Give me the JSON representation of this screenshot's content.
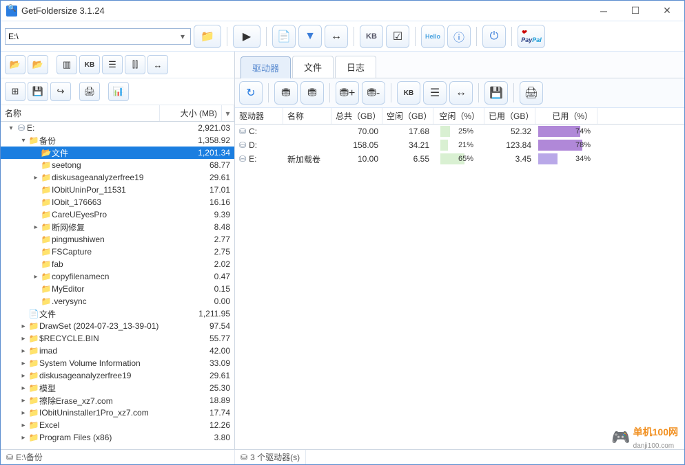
{
  "title": "GetFoldersize 3.1.24",
  "path_value": "E:\\",
  "left_columns": {
    "name": "名称",
    "size": "大小 (MB)"
  },
  "right_columns": {
    "drive": "驱动器",
    "name": "名称",
    "total": "总共（GB）",
    "free": "空闲（GB）",
    "free_pct": "空闲（%）",
    "used": "已用（GB）",
    "used_pct": "已用（%）"
  },
  "tabs": {
    "drives": "驱动器",
    "files": "文件",
    "log": "日志"
  },
  "status": {
    "path": "E:\\备份",
    "drives": "3 个驱动器(s)"
  },
  "watermark": {
    "line1": "单机100网",
    "line2": "danji100.com"
  },
  "tree": [
    {
      "depth": 0,
      "expand": "open",
      "icon": "drive",
      "name": "E:",
      "size": "2,921.03"
    },
    {
      "depth": 1,
      "expand": "open",
      "icon": "folder",
      "name": "备份",
      "size": "1,358.92"
    },
    {
      "depth": 2,
      "expand": "none",
      "icon": "folder-open",
      "name": "文件",
      "size": "1,201.34",
      "selected": true
    },
    {
      "depth": 2,
      "expand": "none",
      "icon": "folder",
      "name": "seetong",
      "size": "68.77"
    },
    {
      "depth": 2,
      "expand": "closed",
      "icon": "folder",
      "name": "diskusageanalyzerfree19",
      "size": "29.61"
    },
    {
      "depth": 2,
      "expand": "none",
      "icon": "folder",
      "name": "IObitUninPor_11531",
      "size": "17.01"
    },
    {
      "depth": 2,
      "expand": "none",
      "icon": "folder",
      "name": "IObit_176663",
      "size": "16.16"
    },
    {
      "depth": 2,
      "expand": "none",
      "icon": "folder",
      "name": "CareUEyesPro",
      "size": "9.39"
    },
    {
      "depth": 2,
      "expand": "closed",
      "icon": "folder",
      "name": "断网修复",
      "size": "8.48"
    },
    {
      "depth": 2,
      "expand": "none",
      "icon": "folder",
      "name": "pingmushiwen",
      "size": "2.77"
    },
    {
      "depth": 2,
      "expand": "none",
      "icon": "folder",
      "name": "FSCapture",
      "size": "2.75"
    },
    {
      "depth": 2,
      "expand": "none",
      "icon": "folder",
      "name": "fab",
      "size": "2.02"
    },
    {
      "depth": 2,
      "expand": "closed",
      "icon": "folder",
      "name": "copyfilenamecn",
      "size": "0.47"
    },
    {
      "depth": 2,
      "expand": "none",
      "icon": "folder",
      "name": "MyEditor",
      "size": "0.15"
    },
    {
      "depth": 2,
      "expand": "none",
      "icon": "folder",
      "name": ".verysync",
      "size": "0.00"
    },
    {
      "depth": 1,
      "expand": "none",
      "icon": "file",
      "name": "文件",
      "size": "1,211.95"
    },
    {
      "depth": 1,
      "expand": "closed",
      "icon": "folder",
      "name": "DrawSet (2024-07-23_13-39-01)",
      "size": "97.54"
    },
    {
      "depth": 1,
      "expand": "closed",
      "icon": "folder",
      "name": "$RECYCLE.BIN",
      "size": "55.77"
    },
    {
      "depth": 1,
      "expand": "closed",
      "icon": "folder",
      "name": "imad",
      "size": "42.00"
    },
    {
      "depth": 1,
      "expand": "closed",
      "icon": "folder",
      "name": "System Volume Information",
      "size": "33.09"
    },
    {
      "depth": 1,
      "expand": "closed",
      "icon": "folder",
      "name": "diskusageanalyzerfree19",
      "size": "29.61"
    },
    {
      "depth": 1,
      "expand": "closed",
      "icon": "folder",
      "name": "模型",
      "size": "25.30"
    },
    {
      "depth": 1,
      "expand": "closed",
      "icon": "folder",
      "name": "擦除Erase_xz7.com",
      "size": "18.89"
    },
    {
      "depth": 1,
      "expand": "closed",
      "icon": "folder",
      "name": "IObitUninstaller1Pro_xz7.com",
      "size": "17.74"
    },
    {
      "depth": 1,
      "expand": "closed",
      "icon": "folder",
      "name": "Excel",
      "size": "12.26"
    },
    {
      "depth": 1,
      "expand": "closed",
      "icon": "folder",
      "name": "Program Files (x86)",
      "size": "3.80"
    }
  ],
  "drives": [
    {
      "drive": "C:",
      "name": "",
      "total": "70.00",
      "free": "17.68",
      "free_pct": "25%",
      "free_fill": 25,
      "used": "52.32",
      "used_pct": "74%",
      "used_fill": 74
    },
    {
      "drive": "D:",
      "name": "",
      "total": "158.05",
      "free": "34.21",
      "free_pct": "21%",
      "free_fill": 21,
      "used": "123.84",
      "used_pct": "78%",
      "used_fill": 78
    },
    {
      "drive": "E:",
      "name": "新加载卷",
      "total": "10.00",
      "free": "6.55",
      "free_pct": "65%",
      "free_fill": 65,
      "used": "3.45",
      "used_pct": "34%",
      "used_fill": 34
    }
  ]
}
